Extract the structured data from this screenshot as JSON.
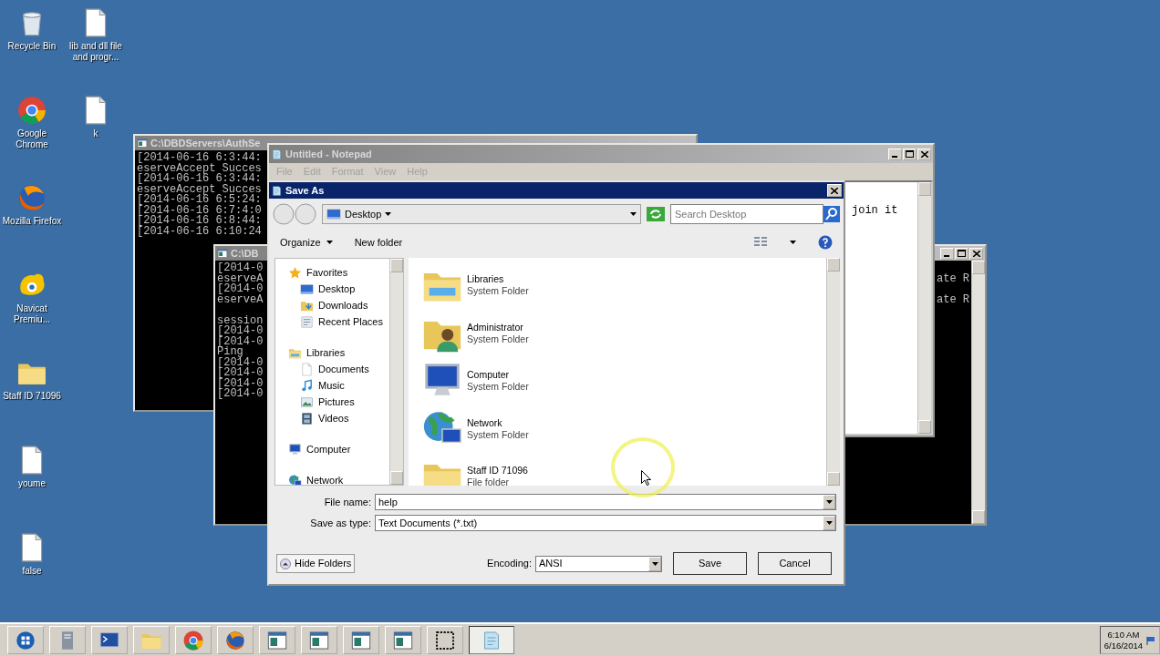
{
  "desktop_icons": [
    {
      "label": "Recycle Bin",
      "kind": "recycle"
    },
    {
      "label": "Google Chrome",
      "kind": "chrome"
    },
    {
      "label": "Mozilla Firefox",
      "kind": "firefox"
    },
    {
      "label": "Navicat Premiu...",
      "kind": "navicat"
    },
    {
      "label": "Staff ID 71096",
      "kind": "folder"
    },
    {
      "label": "youme",
      "kind": "doc"
    },
    {
      "label": "false",
      "kind": "doc"
    },
    {
      "label": "lib and dll file and progr...",
      "kind": "doc"
    },
    {
      "label": "k",
      "kind": "doc"
    }
  ],
  "consoles": [
    {
      "title": "C:\\DBDServers\\AuthSe",
      "lines": [
        {
          "text": "[2014-06-16 6:3:44:"
        },
        {
          "text": "eserveAccept Succes"
        },
        {
          "text": "[2014-06-16 6:3:44:"
        },
        {
          "text": "eserveAccept Succes"
        },
        {
          "text": "[2014-06-16 6:5:24:"
        },
        {
          "text": "[2014-06-16 6:7:4:0"
        },
        {
          "text": "[2014-06-16 6:8:44:"
        },
        {
          "text": "[2014-06-16 6:10:24"
        }
      ]
    },
    {
      "title": "C:\\DB",
      "lines": [
        {
          "text": "[2014-0"
        },
        {
          "text": "eserveA",
          "tail": "ate R"
        },
        {
          "text": "[2014-0"
        },
        {
          "text": "eserveA",
          "tail": "ate R"
        },
        {
          "text": "session",
          "gap_before": true
        },
        {
          "text": "[2014-0"
        },
        {
          "text": "[2014-0"
        },
        {
          "text": "Ping"
        },
        {
          "text": "[2014-0"
        },
        {
          "text": "[2014-0"
        },
        {
          "text": "[2014-0"
        },
        {
          "text": "[2014-0"
        }
      ]
    }
  ],
  "notepad": {
    "title": "Untitled - Notepad",
    "menu": [
      "File",
      "Edit",
      "Format",
      "View",
      "Help"
    ],
    "text": "join it"
  },
  "save_dialog": {
    "title": "Save As",
    "location": "Desktop",
    "search": {
      "placeholder": "Search Desktop"
    },
    "toolbar": [
      "Organize",
      "New folder"
    ],
    "nav": [
      {
        "label": "Favorites",
        "kind": "star",
        "children": [
          {
            "label": "Desktop",
            "kind": "desktop"
          },
          {
            "label": "Downloads",
            "kind": "downloads"
          },
          {
            "label": "Recent Places",
            "kind": "recent"
          }
        ]
      },
      {
        "label": "Libraries",
        "kind": "libraries",
        "children": [
          {
            "label": "Documents",
            "kind": "doc"
          },
          {
            "label": "Music",
            "kind": "music"
          },
          {
            "label": "Pictures",
            "kind": "pictures"
          },
          {
            "label": "Videos",
            "kind": "videos"
          }
        ]
      },
      {
        "label": "Computer",
        "kind": "computer"
      },
      {
        "label": "Network",
        "kind": "network"
      }
    ],
    "items": [
      {
        "name": "Libraries",
        "type": "System Folder",
        "kind": "libraries"
      },
      {
        "name": "Administrator",
        "type": "System Folder",
        "kind": "user"
      },
      {
        "name": "Computer",
        "type": "System Folder",
        "kind": "computer"
      },
      {
        "name": "Network",
        "type": "System Folder",
        "kind": "network"
      },
      {
        "name": "Staff ID 71096",
        "type": "File folder",
        "kind": "folder"
      }
    ],
    "file_name": {
      "label": "File name:",
      "value": "help "
    },
    "save_type": {
      "label": "Save as type:",
      "value": "Text Documents (*.txt)"
    },
    "hide_folders": "Hide Folders",
    "encoding": {
      "label": "Encoding:",
      "value": "ANSI"
    },
    "buttons": [
      "Save",
      "Cancel"
    ]
  },
  "taskbar": {
    "items": [
      {
        "kind": "start",
        "selected": false
      },
      {
        "kind": "server",
        "selected": false
      },
      {
        "kind": "terminal",
        "selected": false
      },
      {
        "kind": "folder",
        "selected": false
      },
      {
        "kind": "chrome",
        "selected": false
      },
      {
        "kind": "firefox",
        "selected": false
      },
      {
        "kind": "console",
        "selected": false
      },
      {
        "kind": "console",
        "selected": false
      },
      {
        "kind": "console",
        "selected": false
      },
      {
        "kind": "console",
        "selected": false
      },
      {
        "kind": "snip",
        "selected": false
      },
      {
        "kind": "notepad",
        "selected": true
      }
    ],
    "time": "6:10 AM",
    "date": "6/16/2014"
  }
}
